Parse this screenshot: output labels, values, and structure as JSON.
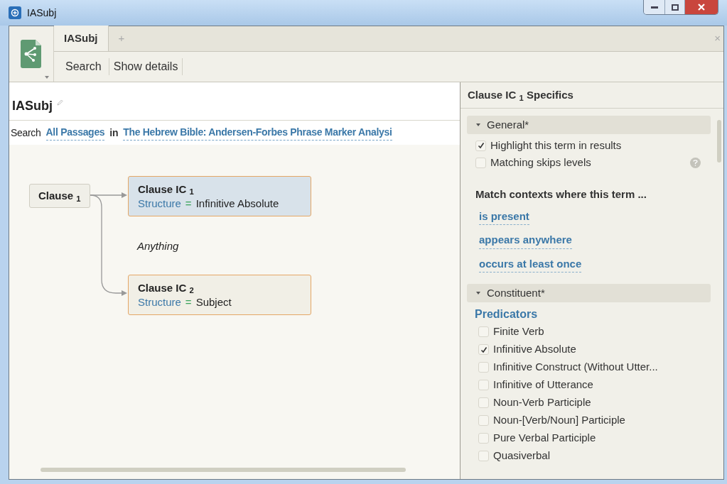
{
  "window": {
    "title": "IASubj"
  },
  "tabs": [
    {
      "label": "IASubj",
      "selected": true
    }
  ],
  "new_tab": "+",
  "close_tab": "×",
  "toolbar": [
    "Search",
    "Show details"
  ],
  "document": {
    "title": "IASubj",
    "search_label": "Search",
    "range": "All Passages",
    "joiner": "in",
    "source": "The Hebrew Bible: Andersen-Forbes Phrase Marker Analysi"
  },
  "diagram": {
    "root": "Clause $_{1}$",
    "between": "Anything",
    "nodes": [
      {
        "label": "Clause IC $_{1}$",
        "field": "Structure",
        "operator": "=",
        "value": "Infinitive Absolute",
        "selected": true
      },
      {
        "label": "Clause IC $_{2}$",
        "field": "Structure",
        "operator": "=",
        "value": "Subject",
        "selected": false
      }
    ]
  },
  "specifics": {
    "title": "Clause IC $_{1}$ Specifics",
    "general": {
      "title": "General*",
      "expanded": true,
      "options": [
        {
          "label": "Highlight this term in results",
          "checked": true
        },
        {
          "label": "Matching skips levels",
          "checked": false
        }
      ],
      "match_heading": "Match contexts where this term ...",
      "dropdowns": [
        "is present",
        "appears anywhere",
        "occurs at least once"
      ]
    },
    "constituent": {
      "title": "Constituent*",
      "expanded": true,
      "group": "Predicators",
      "options": [
        {
          "label": "Finite Verb",
          "checked": false
        },
        {
          "label": "Infinitive Absolute",
          "checked": true
        },
        {
          "label": "Infinitive Construct (Without Utter...",
          "checked": false
        },
        {
          "label": "Infinitive of Utterance",
          "checked": false
        },
        {
          "label": "Noun-Verb Participle",
          "checked": false
        },
        {
          "label": "Noun-[Verb/Noun] Participle",
          "checked": false
        },
        {
          "label": "Pure Verbal Participle",
          "checked": false
        },
        {
          "label": "Quasiverbal",
          "checked": false
        }
      ]
    }
  }
}
